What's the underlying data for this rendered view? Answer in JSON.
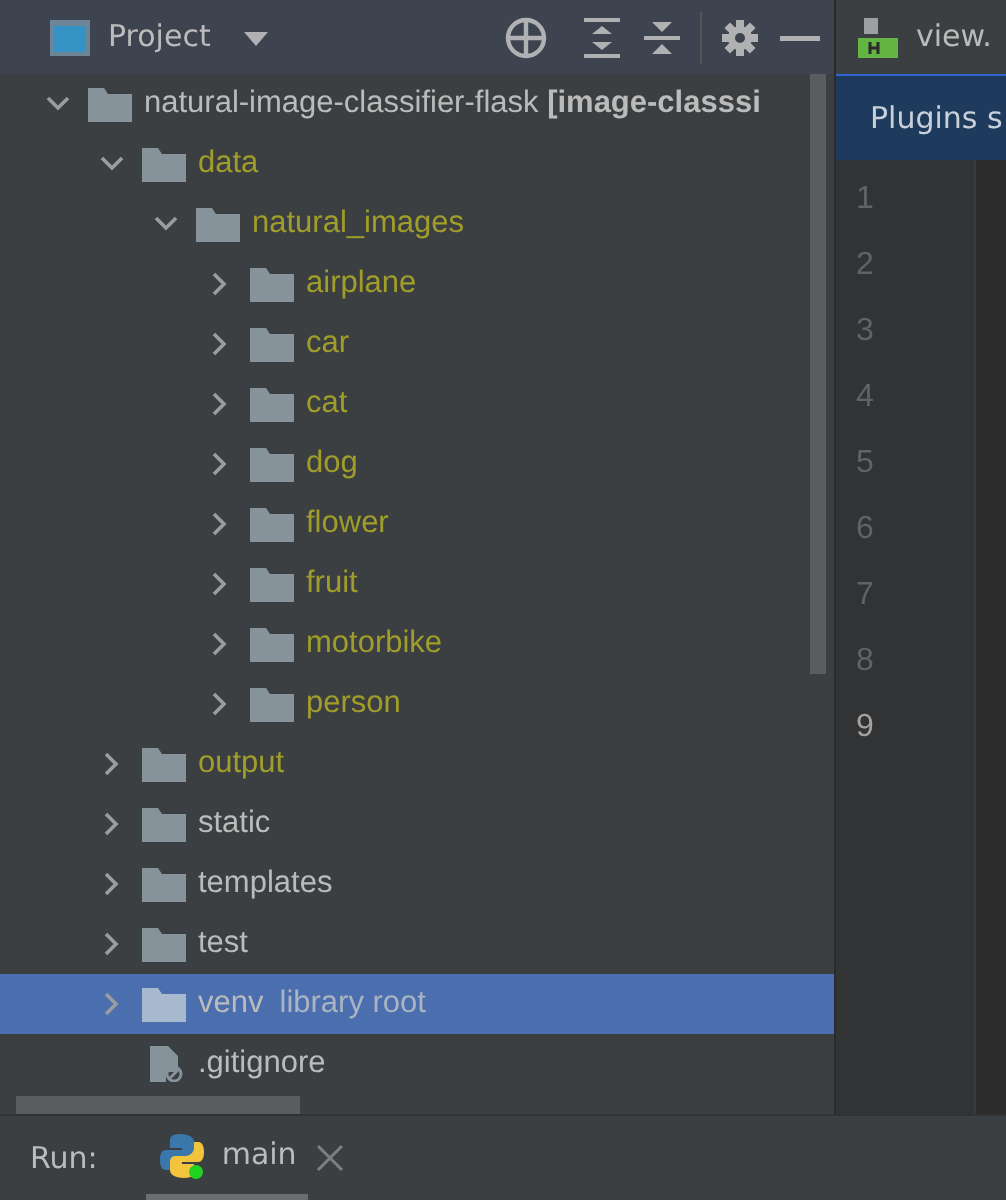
{
  "project_panel": {
    "title": "Project"
  },
  "tree": [
    {
      "label": "natural-image-classifier-flask **[image-classsi**",
      "kind": "folder",
      "expanded": true,
      "selected": false,
      "color": "#bbbbbb",
      "children": [
        {
          "label": "data",
          "kind": "folder",
          "expanded": true,
          "selected": false,
          "color": "#a09d2a",
          "children": [
            {
              "label": "natural_images",
              "kind": "folder",
              "expanded": true,
              "selected": false,
              "color": "#a09d2a",
              "children": [
                {
                  "label": "airplane",
                  "kind": "folder",
                  "expanded": false,
                  "selected": false,
                  "color": "#a09d2a"
                },
                {
                  "label": "car",
                  "kind": "folder",
                  "expanded": false,
                  "selected": false,
                  "color": "#a09d2a"
                },
                {
                  "label": "cat",
                  "kind": "folder",
                  "expanded": false,
                  "selected": false,
                  "color": "#a09d2a"
                },
                {
                  "label": "dog",
                  "kind": "folder",
                  "expanded": false,
                  "selected": false,
                  "color": "#a09d2a"
                },
                {
                  "label": "flower",
                  "kind": "folder",
                  "expanded": false,
                  "selected": false,
                  "color": "#a09d2a"
                },
                {
                  "label": "fruit",
                  "kind": "folder",
                  "expanded": false,
                  "selected": false,
                  "color": "#a09d2a"
                },
                {
                  "label": "motorbike",
                  "kind": "folder",
                  "expanded": false,
                  "selected": false,
                  "color": "#a09d2a"
                },
                {
                  "label": "person",
                  "kind": "folder",
                  "expanded": false,
                  "selected": false,
                  "color": "#a09d2a"
                }
              ]
            }
          ]
        },
        {
          "label": "output",
          "kind": "folder",
          "expanded": false,
          "selected": false,
          "color": "#a09d2a"
        },
        {
          "label": "static",
          "kind": "folder",
          "expanded": false,
          "selected": false,
          "color": "#bbbbbb"
        },
        {
          "label": "templates",
          "kind": "folder",
          "expanded": false,
          "selected": false,
          "color": "#bbbbbb"
        },
        {
          "label": "test",
          "kind": "folder",
          "expanded": false,
          "selected": false,
          "color": "#bbbbbb"
        },
        {
          "label": "venv",
          "suffix": "library root",
          "kind": "folder",
          "expanded": false,
          "selected": true,
          "color": "#bbbbbb"
        },
        {
          "label": ".gitignore",
          "kind": "file",
          "selected": false,
          "color": "#bbbbbb"
        }
      ]
    }
  ],
  "editor": {
    "tab": {
      "label": "view."
    },
    "banner": "Plugins s",
    "lines": [
      {
        "number": "1",
        "current": false
      },
      {
        "number": "2",
        "current": false
      },
      {
        "number": "3",
        "current": false
      },
      {
        "number": "4",
        "current": false
      },
      {
        "number": "5",
        "current": false
      },
      {
        "number": "6",
        "current": false
      },
      {
        "number": "7",
        "current": false
      },
      {
        "number": "8",
        "current": false
      },
      {
        "number": "9",
        "current": true
      }
    ]
  },
  "run_bar": {
    "label": "Run:",
    "tabs": [
      {
        "label": "main",
        "selected": true
      }
    ]
  }
}
